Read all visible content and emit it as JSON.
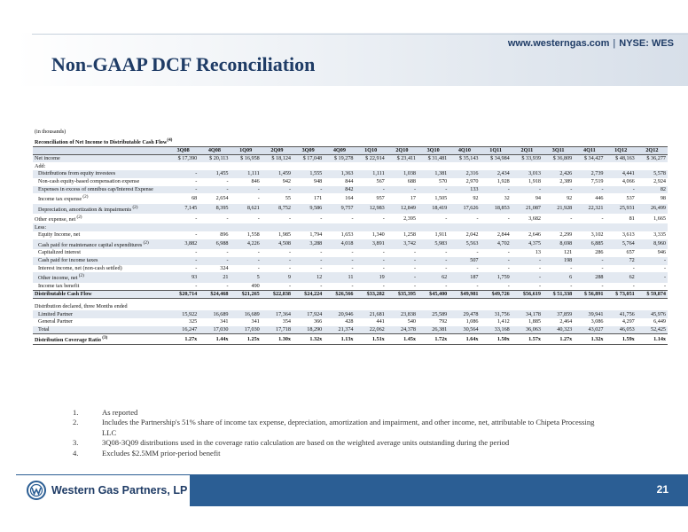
{
  "header": {
    "site": "www.westerngas.com",
    "ticker": "NYSE: WES",
    "title": "Non-GAAP DCF Reconciliation"
  },
  "table": {
    "units": "(in thousands)",
    "caption": "Reconciliation of Net Income to Distributable Cash Flow",
    "caption_sup": "(4)",
    "columns": [
      "3Q08",
      "4Q08",
      "1Q09",
      "2Q09",
      "3Q09",
      "4Q09",
      "1Q10",
      "2Q10",
      "3Q10",
      "4Q10",
      "1Q11",
      "2Q11",
      "3Q11",
      "4Q11",
      "1Q12",
      "2Q12"
    ],
    "rows": [
      {
        "label": "Net income",
        "style": "shade topline",
        "values": [
          "$ 17,390",
          "$ 20,113",
          "$ 16,958",
          "$ 18,124",
          "$ 17,048",
          "$ 19,278",
          "$ 22,914",
          "$ 23,411",
          "$ 31,481",
          "$ 35,143",
          "$ 34,984",
          "$ 33,939",
          "$ 36,809",
          "$ 34,427",
          "$ 48,163",
          "$ 36,277"
        ]
      },
      {
        "label": "Add:",
        "style": "",
        "values": [
          "",
          "",
          "",
          "",
          "",
          "",
          "",
          "",
          "",
          "",
          "",
          "",
          "",
          "",
          "",
          ""
        ]
      },
      {
        "label": "Distributions from equity investees",
        "style": "shade ind1",
        "values": [
          "-",
          "1,455",
          "1,111",
          "1,459",
          "1,555",
          "1,363",
          "1,111",
          "1,038",
          "1,381",
          "2,316",
          "2,434",
          "3,013",
          "2,426",
          "2,739",
          "4,441",
          "5,578"
        ]
      },
      {
        "label": "Non-cash equity-based compensation expense",
        "style": "ind1",
        "values": [
          "-",
          "-",
          "846",
          "942",
          "948",
          "844",
          "567",
          "688",
          "570",
          "2,970",
          "1,928",
          "1,918",
          "2,389",
          "7,519",
          "4,066",
          "2,924"
        ]
      },
      {
        "label": "Expenses in excess of omnibus cap/Interest Expense",
        "style": "shade ind1",
        "values": [
          "-",
          "-",
          "-",
          "-",
          "-",
          "842",
          "-",
          "-",
          "-",
          "133",
          "-",
          "-",
          "-",
          "-",
          "-",
          "82"
        ]
      },
      {
        "label": "Income tax expense",
        "sup": "(2)",
        "style": "ind1",
        "values": [
          "68",
          "2,654",
          "-",
          "55",
          "171",
          "164",
          "957",
          "17",
          "1,505",
          "92",
          "32",
          "94",
          "92",
          "446",
          "537",
          "98"
        ]
      },
      {
        "label": "Depreciation, amortization & impairments",
        "sup": "(2)",
        "style": "shade ind1",
        "values": [
          "7,145",
          "8,395",
          "8,621",
          "8,752",
          "9,586",
          "9,757",
          "12,983",
          "12,849",
          "18,419",
          "17,626",
          "18,853",
          "21,087",
          "21,928",
          "22,321",
          "25,931",
          "26,499"
        ]
      },
      {
        "label": "Other expense, net",
        "sup": "(2)",
        "style": "",
        "values": [
          "-",
          "-",
          "-",
          "-",
          "-",
          "-",
          "-",
          "2,395",
          "-",
          "-",
          "-",
          "3,682",
          "-",
          "-",
          "81",
          "1,665"
        ]
      },
      {
        "label": "Less:",
        "style": "shade",
        "values": [
          "",
          "",
          "",
          "",
          "",
          "",
          "",
          "",
          "",
          "",
          "",
          "",
          "",
          "",
          "",
          ""
        ]
      },
      {
        "label": "Equity Income, net",
        "style": "ind1",
        "values": [
          "-",
          "896",
          "1,558",
          "1,985",
          "1,794",
          "1,653",
          "1,340",
          "1,258",
          "1,911",
          "2,042",
          "2,844",
          "2,646",
          "2,299",
          "3,102",
          "3,613",
          "3,335"
        ]
      },
      {
        "label": "Cash paid for maintenance capital expenditures",
        "sup": "(2)",
        "style": "shade ind1",
        "values": [
          "3,882",
          "6,988",
          "4,226",
          "4,508",
          "3,288",
          "4,018",
          "3,891",
          "3,742",
          "5,983",
          "5,563",
          "4,702",
          "4,375",
          "8,698",
          "6,885",
          "5,764",
          "8,960"
        ]
      },
      {
        "label": "Capitalized interest",
        "style": "ind1",
        "values": [
          "-",
          "-",
          "-",
          "-",
          "-",
          "-",
          "-",
          "-",
          "-",
          "-",
          "-",
          "13",
          "121",
          "286",
          "657",
          "946"
        ]
      },
      {
        "label": "Cash paid for income taxes",
        "style": "shade ind1",
        "values": [
          "-",
          "-",
          "-",
          "-",
          "-",
          "-",
          "-",
          "-",
          "-",
          "507",
          "-",
          "-",
          "198",
          "-",
          "72",
          "-"
        ]
      },
      {
        "label": "Interest income, net (non-cash settled)",
        "style": "ind1",
        "values": [
          "-",
          "324",
          "-",
          "-",
          "-",
          "-",
          "-",
          "-",
          "-",
          "-",
          "-",
          "-",
          "-",
          "-",
          "-",
          "-"
        ]
      },
      {
        "label": "Other income, net",
        "sup": "(2)",
        "style": "shade ind1",
        "values": [
          "93",
          "21",
          "5",
          "9",
          "12",
          "11",
          "19",
          "-",
          "62",
          "187",
          "1,759",
          "-",
          "6",
          "288",
          "62",
          "-"
        ]
      },
      {
        "label": "Income tax benefit",
        "style": "ind1",
        "values": [
          "-",
          "-",
          "490",
          "-",
          "-",
          "-",
          "-",
          "-",
          "-",
          "-",
          "-",
          "-",
          "-",
          "-",
          "-",
          "-"
        ]
      },
      {
        "label": "Distributable Cash Flow",
        "style": "shade bold topline botline",
        "values": [
          "$20,714",
          "$24,468",
          "$21,265",
          "$22,838",
          "$24,224",
          "$26,566",
          "$33,282",
          "$35,395",
          "$45,400",
          "$49,981",
          "$49,726",
          "$56,619",
          "$ 51,338",
          "$ 56,891",
          "$ 73,051",
          "$ 59,874"
        ]
      },
      {
        "label": "",
        "style": "spacer",
        "values": [
          "",
          "",
          "",
          "",
          "",
          "",
          "",
          "",
          "",
          "",
          "",
          "",
          "",
          "",
          "",
          ""
        ]
      },
      {
        "label": "Distribution declared, three Months ended",
        "style": "",
        "values": [
          "",
          "",
          "",
          "",
          "",
          "",
          "",
          "",
          "",
          "",
          "",
          "",
          "",
          "",
          "",
          ""
        ]
      },
      {
        "label": "Limited Partner",
        "style": "shade ind1",
        "values": [
          "15,922",
          "16,689",
          "16,689",
          "17,364",
          "17,924",
          "20,946",
          "21,681",
          "23,838",
          "25,589",
          "29,478",
          "31,756",
          "34,178",
          "37,859",
          "39,941",
          "41,756",
          "45,976"
        ]
      },
      {
        "label": "General Partner",
        "style": "ind1",
        "values": [
          "325",
          "341",
          "341",
          "354",
          "366",
          "428",
          "441",
          "540",
          "792",
          "1,086",
          "1,412",
          "1,885",
          "2,464",
          "3,086",
          "4,297",
          "6,449"
        ]
      },
      {
        "label": "Total",
        "style": "shade ind1",
        "values": [
          "16,247",
          "17,030",
          "17,030",
          "17,718",
          "18,290",
          "21,374",
          "22,062",
          "24,378",
          "26,381",
          "30,564",
          "33,168",
          "36,063",
          "40,323",
          "43,027",
          "46,053",
          "52,425"
        ]
      },
      {
        "label": "Distribution Coverage Ratio",
        "sup": "(3)",
        "style": "bold topline botline",
        "values": [
          "1.27x",
          "1.44x",
          "1.25x",
          "1.30x",
          "1.32x",
          "1.13x",
          "1.51x",
          "1.45x",
          "1.72x",
          "1.64x",
          "1.50x",
          "1.57x",
          "1.27x",
          "1.32x",
          "1.59x",
          "1.14x"
        ]
      }
    ]
  },
  "notes": [
    {
      "n": "1.",
      "text": "As reported"
    },
    {
      "n": "2.",
      "text": "Includes the Partnership's 51% share of income tax expense, depreciation, amortization and impairment, and other income, net, attributable to Chipeta Processing LLC"
    },
    {
      "n": "3.",
      "text": "3Q08-3Q09 distributions used in the coverage ratio calculation are based on the weighted average units outstanding during the period"
    },
    {
      "n": "4.",
      "text": "Excludes $2.5MM prior-period benefit"
    }
  ],
  "footer": {
    "company": "Western Gas Partners, LP",
    "page": "21",
    "colors": {
      "brand_blue": "#2b5e94",
      "title_blue": "#1f3c66"
    }
  }
}
